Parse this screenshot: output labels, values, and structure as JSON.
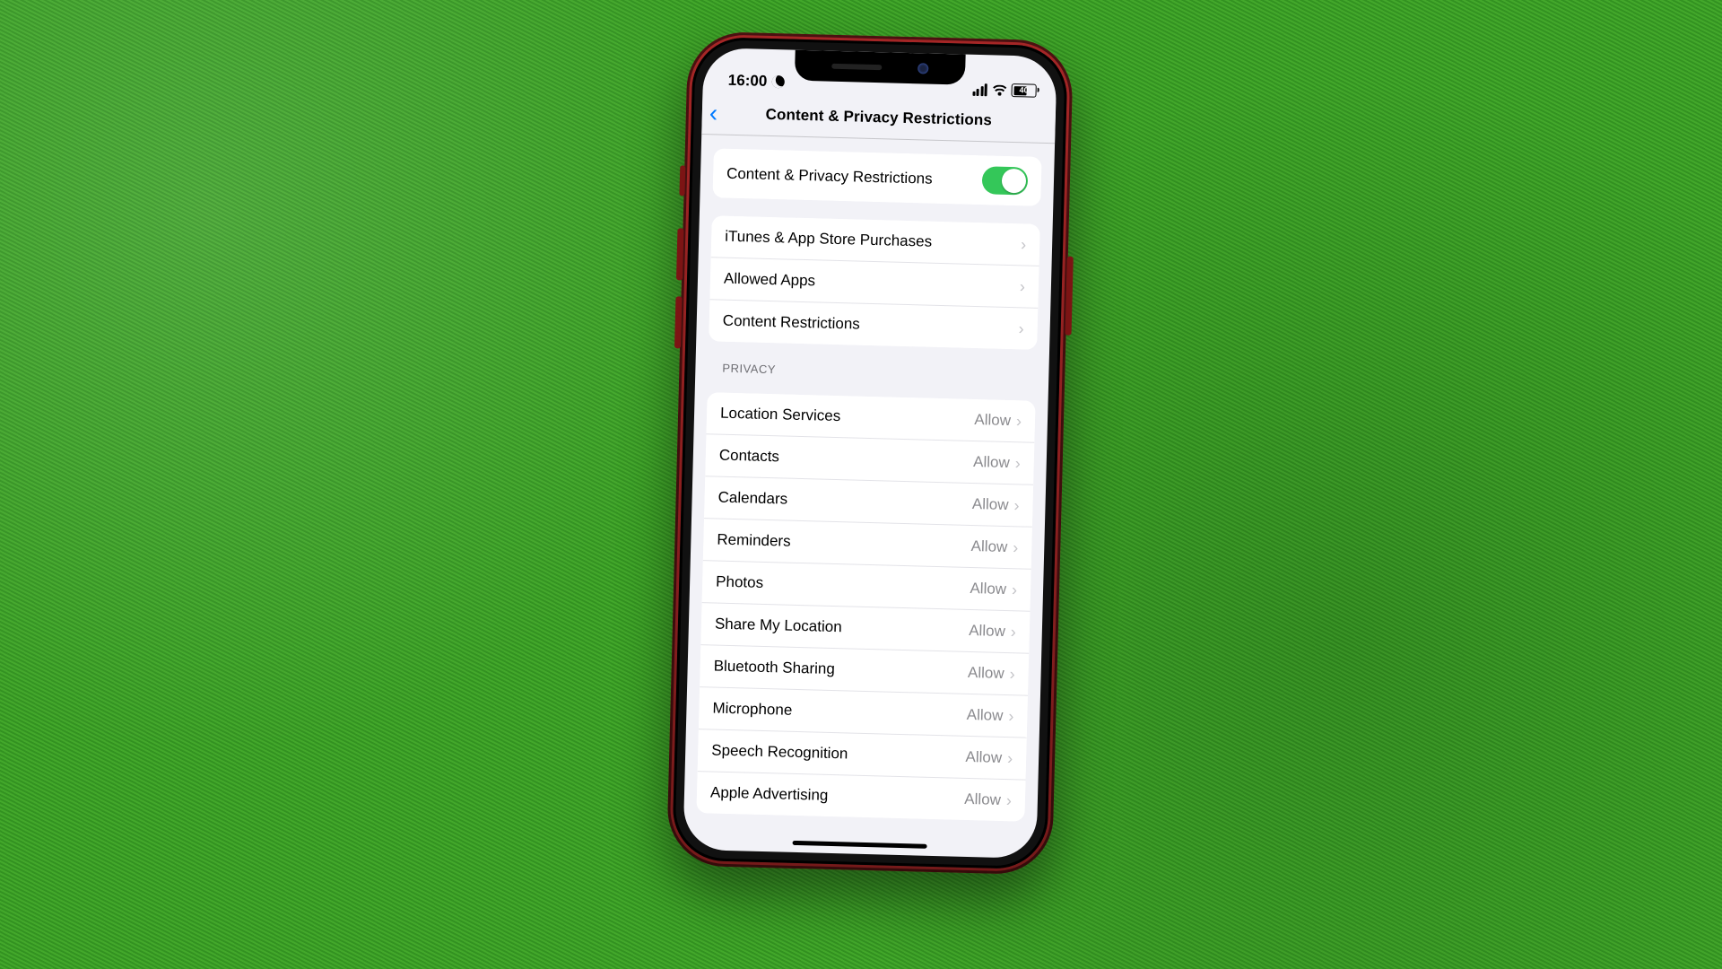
{
  "status": {
    "time": "16:00",
    "battery_text": "40"
  },
  "nav": {
    "title": "Content & Privacy Restrictions"
  },
  "toggle_row": {
    "label": "Content & Privacy Restrictions",
    "on": true
  },
  "main_rows": [
    {
      "label": "iTunes & App Store Purchases"
    },
    {
      "label": "Allowed Apps"
    },
    {
      "label": "Content Restrictions"
    }
  ],
  "privacy_header": "PRIVACY",
  "privacy_rows": [
    {
      "label": "Location Services",
      "value": "Allow"
    },
    {
      "label": "Contacts",
      "value": "Allow"
    },
    {
      "label": "Calendars",
      "value": "Allow"
    },
    {
      "label": "Reminders",
      "value": "Allow"
    },
    {
      "label": "Photos",
      "value": "Allow"
    },
    {
      "label": "Share My Location",
      "value": "Allow"
    },
    {
      "label": "Bluetooth Sharing",
      "value": "Allow"
    },
    {
      "label": "Microphone",
      "value": "Allow"
    },
    {
      "label": "Speech Recognition",
      "value": "Allow"
    },
    {
      "label": "Apple Advertising",
      "value": "Allow"
    }
  ]
}
